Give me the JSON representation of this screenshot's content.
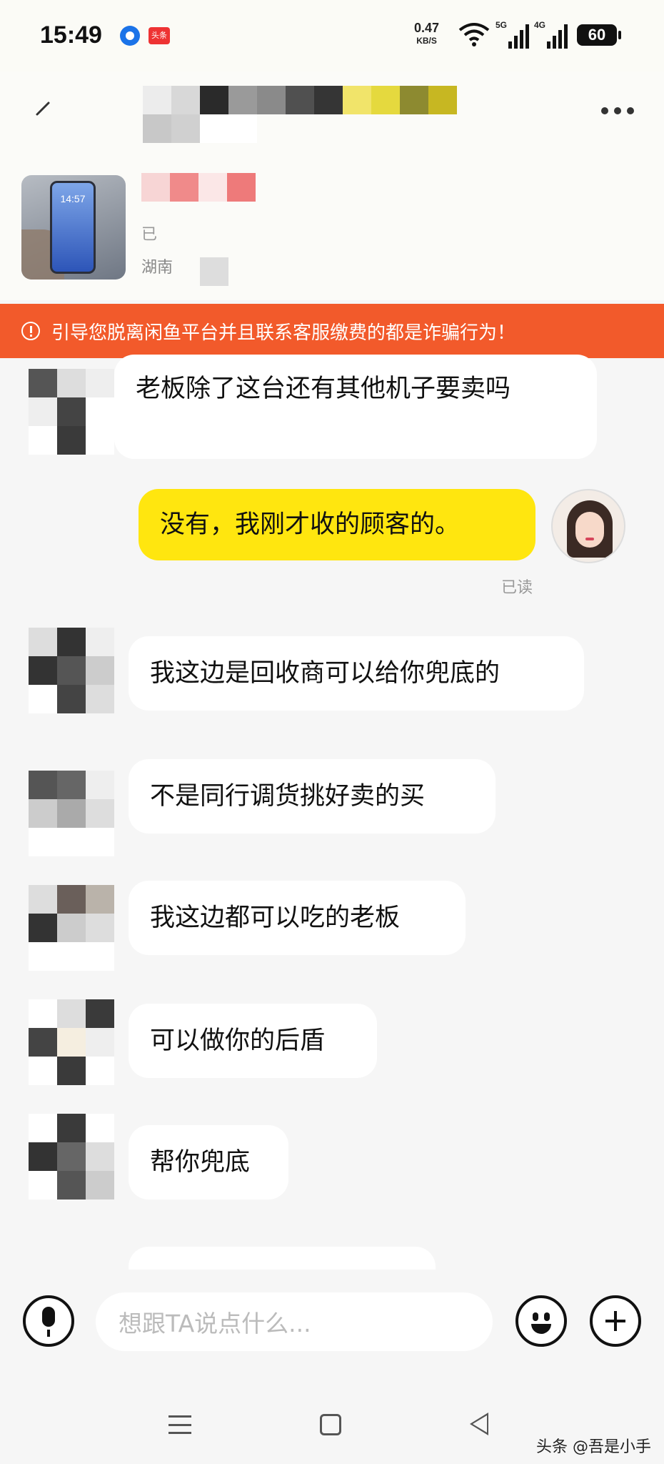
{
  "status_bar": {
    "time": "15:49",
    "notification_app": "头条",
    "net_speed": "0.47",
    "net_speed_unit": "KB/S",
    "sim1": "5G",
    "sim2": "4G",
    "battery": "60"
  },
  "header": {
    "product_sub": "已",
    "product_location": "湖南",
    "phone_screen_time": "14:57"
  },
  "warning": {
    "text": "引导您脱离闲鱼平台并且联系客服缴费的都是诈骗行为！"
  },
  "messages": [
    {
      "from": "other",
      "text": "老板除了这台还有其他机子要卖吗"
    },
    {
      "from": "me",
      "text": "没有，我刚才收的顾客的。"
    },
    {
      "from": "other",
      "text": "我这边是回收商可以给你兜底的"
    },
    {
      "from": "other",
      "text": "不是同行调货挑好卖的买"
    },
    {
      "from": "other",
      "text": "我这边都可以吃的老板"
    },
    {
      "from": "other",
      "text": "可以做你的后盾"
    },
    {
      "from": "other",
      "text": "帮你兜底"
    }
  ],
  "read_receipt": "已读",
  "input": {
    "placeholder": "想跟TA说点什么..."
  },
  "watermark": "头条 @吾是小手",
  "colors": {
    "warning_bg": "#f25a2b",
    "my_bubble": "#ffe60f",
    "other_bubble": "#ffffff"
  },
  "icons": [
    "back-icon",
    "more-icon",
    "mic-icon",
    "emoji-icon",
    "add-icon",
    "menu-icon",
    "home-icon",
    "nav-back-icon",
    "warning-icon",
    "wifi-icon",
    "battery-icon"
  ]
}
